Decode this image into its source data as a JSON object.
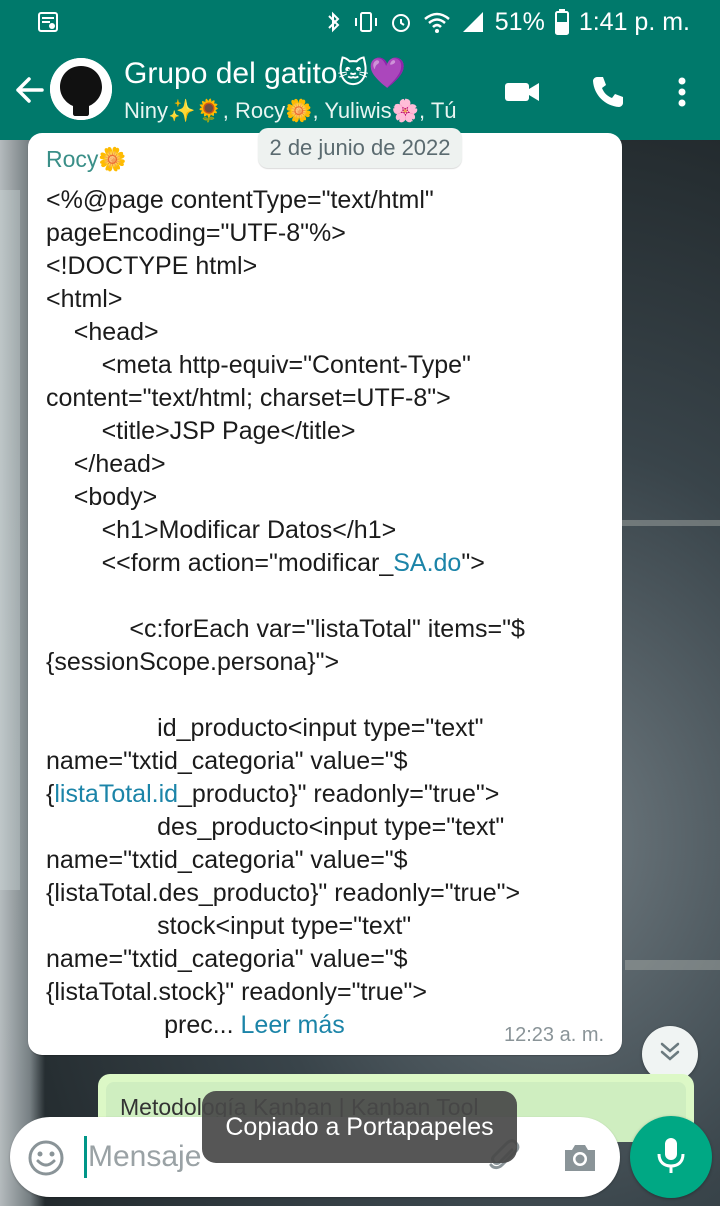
{
  "status_bar": {
    "battery": "51%",
    "time": "1:41 p. m."
  },
  "header": {
    "title": "Grupo del gatito🐱💜",
    "subtitle": "Niny✨🌻, Rocy🌼, Yuliwis🌸, Tú"
  },
  "chat": {
    "date_chip": "2 de junio de 2022",
    "message": {
      "sender": "Rocy🌼",
      "lines": [
        "<%@page contentType=\"text/html\"",
        "pageEncoding=\"UTF-8\"%>",
        "<!DOCTYPE html>",
        "<html>",
        "    <head>",
        "        <meta http-equiv=\"Content-Type\"",
        "content=\"text/html; charset=UTF-8\">",
        "        <title>JSP Page</title>",
        "    </head>",
        "    <body>",
        "        <h1>Modificar Datos</h1>",
        "        <<form action=\"modificar_",
        "",
        "            <c:forEach var=\"listaTotal\" items=\"$",
        "{sessionScope.persona}\">",
        "",
        "                id_producto<input type=\"text\"",
        "name=\"txtid_categoria\" value=\"$",
        "{",
        "                des_producto<input type=\"text\"",
        "name=\"txtid_categoria\" value=\"$",
        "{listaTotal.des_producto}\" readonly=\"true\">",
        "                stock<input type=\"text\"",
        "name=\"txtid_categoria\" value=\"$",
        "{listaTotal.stock}\" readonly=\"true\">",
        "                 prec... "
      ],
      "link_1": "SA.do",
      "link_1_after": "\">",
      "link_2": "listaTotal.id",
      "link_2_after": "_producto}\" readonly=\"true\">",
      "read_more": "Leer más",
      "time": "12:23 a. m."
    },
    "outgoing_preview": "Metodología Kanban | Kanban Tool"
  },
  "composer": {
    "placeholder": "Mensaje"
  },
  "toast": "Copiado a Portapapeles",
  "colors": {
    "primary": "#00796b",
    "accent": "#00a884",
    "link": "#1b84a8"
  },
  "icons": [
    "back-arrow-icon",
    "video-call-icon",
    "phone-icon",
    "more-vert-icon",
    "emoji-icon",
    "attach-icon",
    "camera-icon",
    "mic-icon",
    "chevrons-down-icon"
  ]
}
